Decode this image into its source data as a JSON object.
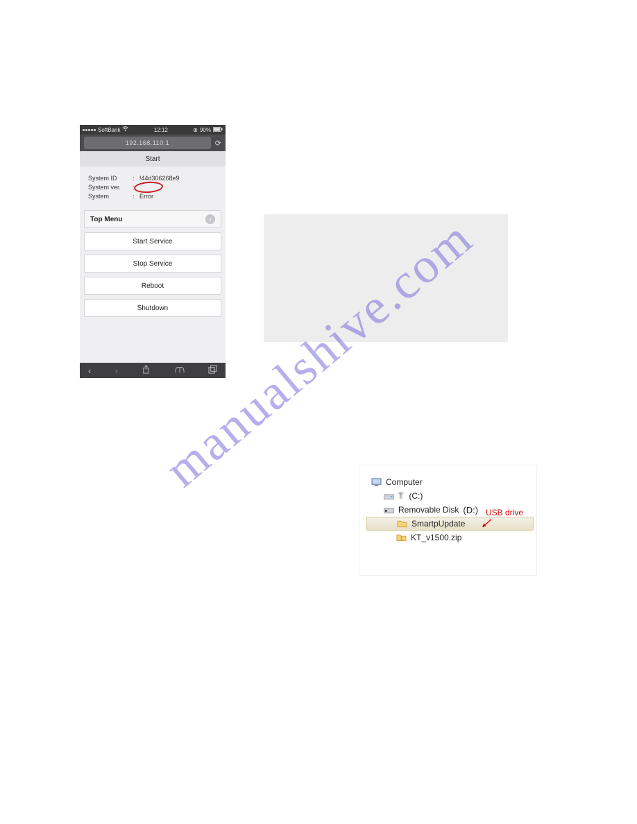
{
  "watermark": {
    "text": "manualshive.com"
  },
  "phone": {
    "status": {
      "carrier": "SoftBank",
      "time": "12:12",
      "battery": "90%"
    },
    "url": "192.168.110.1",
    "title": "Start",
    "info": {
      "system_id_label": "System ID",
      "system_id_value": "!44d306268e9",
      "system_ver_label": "System ver.",
      "system_ver_value": "",
      "system_label": "System",
      "system_value": "Error"
    },
    "menu": {
      "top_menu": "Top Menu",
      "start_service": "Start Service",
      "stop_service": "Stop Service",
      "reboot": "Reboot",
      "shutdown": "Shutdown"
    }
  },
  "explorer": {
    "computer": "Computer",
    "c_drive_name": "T",
    "c_drive_suffix": "(C:)",
    "removable": "Removable Disk",
    "d_drive": "(D:)",
    "folder": "SmartpUpdate",
    "file": "KT_v1500.zip",
    "usb_note": "USB drive"
  }
}
